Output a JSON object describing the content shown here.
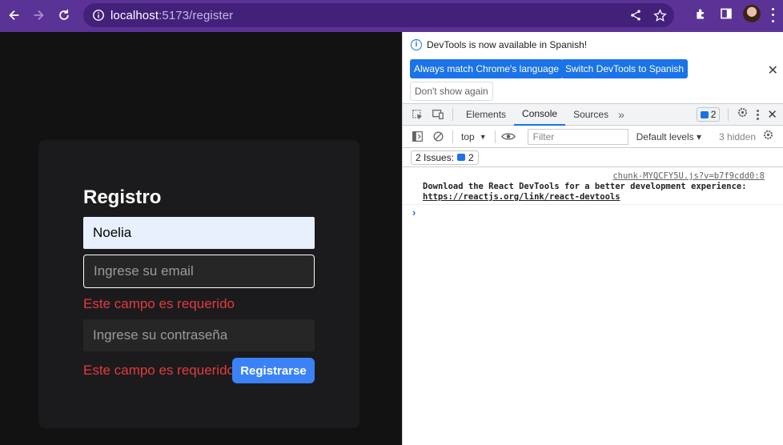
{
  "browser": {
    "url_host": "localhost",
    "url_rest": ":5173/register",
    "icons": [
      "back-icon",
      "forward-icon",
      "reload-icon",
      "info-icon",
      "share-icon",
      "star-icon",
      "extensions-icon",
      "side-panel-icon",
      "profile-avatar",
      "chrome-menu-icon"
    ]
  },
  "page": {
    "title": "Registro",
    "name_value": "Noelia",
    "email_placeholder": "Ingrese su email",
    "email_error": "Este campo es requerido",
    "password_placeholder": "Ingrese su contraseña",
    "password_error": "Este campo es requerido",
    "submit_label": "Registrarse",
    "colors": {
      "background": "#121212",
      "card": "#1b1b1d",
      "error": "#e23b3b",
      "button": "#3b82f6",
      "autofill": "#e8f0fe"
    }
  },
  "devtools": {
    "notice": "DevTools is now available in Spanish!",
    "match_language_button": "Always match Chrome's language",
    "switch_language_button": "Switch DevTools to Spanish",
    "dont_show_button": "Don't show again",
    "tabs": [
      {
        "label": "Elements",
        "active": false
      },
      {
        "label": "Console",
        "active": true
      },
      {
        "label": "Sources",
        "active": false
      }
    ],
    "messages_count": "2",
    "context": "top",
    "filter_placeholder": "Filter",
    "levels_label": "Default levels ▾",
    "hidden_label": "3 hidden",
    "issues_label": "2 Issues:",
    "issues_count": "2",
    "log": {
      "source": "chunk-MYQCFY5U.js?v=b7f9cdd0:8",
      "message": "Download the React DevTools for a better development experience:",
      "link": "https://reactjs.org/link/react-devtools"
    },
    "prompt": "›"
  }
}
